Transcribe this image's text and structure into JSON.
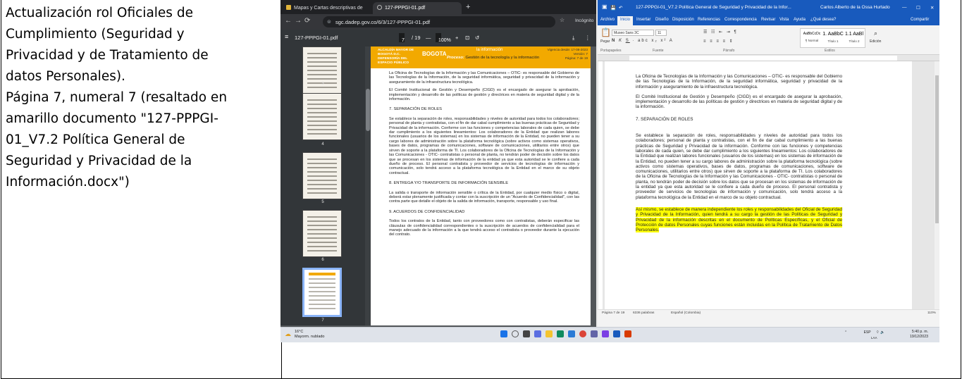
{
  "caption": {
    "lines": [
      "Actualización rol Oficiales de",
      "Cumplimiento (Seguridad y",
      "Privacidad y de Tratamiento de",
      "datos Personales).",
      "Página 7, numeral 7 (resaltado en",
      "amarillo documento \"127-PPPGI-",
      "01_V7.2 Política General de",
      "Seguridad y Privacidad de la",
      "Información.docx\")"
    ]
  },
  "browser": {
    "tabs": [
      "Mapas y Cartas descriptivas de",
      "127-PPPGI-01.pdf"
    ],
    "new_tab": "+",
    "url": "sgc.dadep.gov.co/6/3/127-PPPGI-01.pdf",
    "incognito": "Incógnito",
    "pdf": {
      "filename": "127-PPPGI-01.pdf",
      "page_current": "7",
      "page_total": "/ 19",
      "zoom": "100%",
      "zoom_minus": "—",
      "zoom_plus": "+",
      "thumb_numbers": [
        "3",
        "4",
        "5",
        "6",
        "7"
      ],
      "header": {
        "ministry": "ALCALDÍA MAYOR DE BOGOTÁ D.C. DEFENSORÍA DEL ESPACIO PÚBLICO",
        "bogota": "BOGOTA",
        "process_label": "Proceso:",
        "process": "Gestión de la tecnología y la información",
        "title_frag": "la información",
        "vigencia": "Vigencia desde: 17-08-2023",
        "version": "Versión: 7",
        "pagina": "Página: 7 de 19"
      },
      "paragraphs": [
        "La Oficina de Tecnologías de la Información y las Comunicaciones – OTIC- es responsable del Gobierno de las Tecnologías de la Información, de la seguridad informática, seguridad y privacidad de la información y aseguramiento de la infraestructura tecnológica.",
        "El Comité Institucional de Gestión y Desempeño (CIGD) es el encargado de asegurar la aprobación, implementación y desarrollo de las políticas de gestión y directrices en materia de seguridad digital y de la información."
      ],
      "heading7": "7. SEPARACIÓN DE ROLES",
      "section7": "Se establece la separación de roles, responsabilidades y niveles de autoridad para todos los colaboradores; personal de planta y contratistas, con el fin de dar cabal cumplimiento a las buenas prácticas de Seguridad y Privacidad de la información. Conforme con las funciones y competencias laborales de cada quien, se debe dar cumplimiento a los siguientes lineamientos: Los colaboradores de la Entidad que realizan labores funcionales (usuarios de los sistemas) en los sistemas de información de la Entidad, no pueden tener a su cargo labores de administración sobre la plataforma tecnológica (sobre activos como sistemas operativos, bases de datos, programas de comunicaciones, software de comunicaciones, utilitarios entre otros) que sirven de soporte a la plataforma de TI. Los colaboradores de la Oficina de Tecnologías de la Información y las Comunicaciones - OTIC- contratistas o personal de planta, no tendrán poder de decisión sobre los datos que se procesan en los sistemas de información de la entidad ya que esta autoridad se le confiere a cada dueño de proceso. El personal contratista y proveedor de servicios de tecnologías de información y comunicación, solo tendrá acceso a la plataforma tecnológica de la Entidad en el marco de su objeto contractual.",
      "heading8": "8. ENTREGA Y/O TRANSPORTE DE INFORMACIÓN SENSIBLE",
      "section8": "La salida o transporte de información sensible o crítica de la Entidad, por cualquier medio físico o digital, deberá estar plenamente justificada y contar con la suscripción de un \"Acuerdo de Confidencialidad\", con las contra parte que detalle el objeto de la salida de información, transporte, responsable y uso final.",
      "heading9": "9. ACUERDOS DE CONFIDENCIALIDAD",
      "section9": "Todos los contratos de la Entidad, tanto con proveedores como con contratistas, deberán especificar las cláusulas de confidencialidad correspondientes o la suscripción de acuerdos de confidencialidad para el manejo adecuado de la información a la que tendrá acceso el contratista o proveedor durante la ejecución del contrato."
    }
  },
  "word": {
    "title": "127-PPPGI-01_V7.2 Política General de Seguridad y Privacidad de la Infor...",
    "user": "Carlos Alberto de la Ossa Hurtado",
    "menu": [
      "Archivo",
      "Inicio",
      "Insertar",
      "Diseño",
      "Disposición",
      "Referencias",
      "Correspondencia",
      "Revisar",
      "Vista",
      "Ayuda",
      "¿Qué desea?",
      "Compartir"
    ],
    "font": "Museo Sans 3C",
    "size": "11",
    "groups": [
      "Portapapeles",
      "Fuente",
      "Párrafo",
      "Estilos"
    ],
    "paste": "Pegar",
    "edition": "Edición",
    "styles": [
      {
        "sample": "AaBbCcDc",
        "name": "¶ Normal"
      },
      {
        "sample": "1. AaBbC",
        "name": "Título 1"
      },
      {
        "sample": "1.1 AaBl",
        "name": "Título 2"
      }
    ],
    "paragraphs": [
      "La Oficina de Tecnologías de la Información y las Comunicaciones – OTIC- es responsable del Gobierno de las Tecnologías de la Información, de la seguridad informática, seguridad y privacidad de la información y aseguramiento de la infraestructura tecnológica.",
      "El Comité Institucional de Gestión y Desempeño (CIGD) es el encargado de asegurar la aprobación, implementación y desarrollo de las políticas de gestión y directrices en materia de seguridad digital y de la información."
    ],
    "heading7": "7.   SEPARACIÓN DE ROLES",
    "section7": "Se establece la separación de roles, responsabilidades y niveles de autoridad para todos los colaboradores; personal de planta y contratistas, con el fin de dar cabal cumplimiento a las buenas prácticas de Seguridad y Privacidad de la información. Conforme con las funciones y competencias laborales de cada quien, se debe dar cumplimiento a los siguientes lineamientos: Los colaboradores de la Entidad que realizan labores funcionales (usuarios de los sistemas) en los sistemas de información de la Entidad, no pueden tener a su cargo labores de administración sobre la plataforma tecnológica (sobre activos como sistemas operativos, bases de datos, programas de comunicaciones, software de comunicaciones, utilitarios entre otros) que sirven de soporte a la plataforma de TI. Los colaboradores de la Oficina de Tecnologías de la Información y las Comunicaciones - OTIC- contratistas o personal de planta, no tendrán poder de decisión sobre los datos que se procesan en los sistemas de información de la entidad ya que esta autoridad se le confiere a cada dueño de proceso. El personal contratista y proveedor de servicios de tecnologías de información y comunicación, solo tendrá acceso a la plataforma tecnológica de la Entidad en el marco de su objeto contractual.",
    "highlight": "Así mismo, se establece de manera independiente los roles y responsabilidades del Oficial de Seguridad y Privacidad de la Información, quien tendrá a su cargo la gestión de las Políticas de Seguridad y Privacidad de la información descritas en el documento de Políticas Específicas, y el Oficial de Protección de datos Personales cuyas funciones están incluidas en la Política de Tratamiento de Datos Personales.",
    "status": {
      "page": "Página 7 de 19",
      "words": "6336 palabras",
      "language": "Español (Colombia)",
      "zoom": "110%"
    }
  },
  "taskbar": {
    "temp": "16°C",
    "weather": "Mayorm. nublado",
    "lang": "ESP",
    "layout": "LAA",
    "time": "5:40 p. m.",
    "date": "19/12/2023"
  },
  "colors": {
    "pdf_header": "#f2a900",
    "word_blue": "#185abd",
    "highlight": "#ffff00"
  }
}
